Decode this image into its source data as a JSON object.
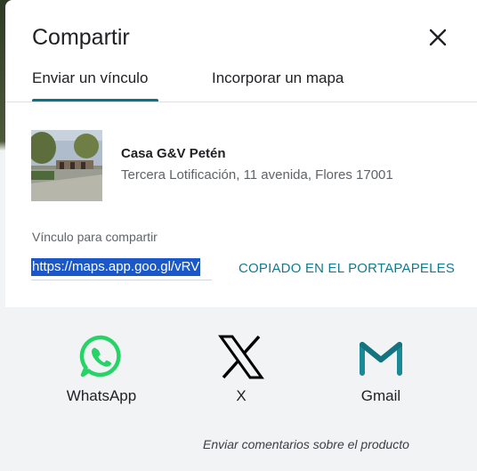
{
  "dialog": {
    "title": "Compartir",
    "close_icon": "close-icon"
  },
  "tabs": [
    {
      "label": "Enviar un vínculo",
      "active": true
    },
    {
      "label": "Incorporar un mapa",
      "active": false
    }
  ],
  "place": {
    "name": "Casa G&V Petén",
    "address": "Tercera Lotificación, 11 avenida, Flores 17001"
  },
  "share_link": {
    "label": "Vínculo para compartir",
    "url": "https://maps.app.goo.gl/vRV",
    "copied_status": "COPIADO EN EL PORTAPAPELES"
  },
  "share_targets": [
    {
      "label": "WhatsApp",
      "icon": "whatsapp-icon",
      "color": "#25d366"
    },
    {
      "label": "X",
      "icon": "x-logo-icon",
      "color": "#000000"
    },
    {
      "label": "Gmail",
      "icon": "gmail-icon",
      "color": "#1a8a96"
    }
  ],
  "feedback": "Enviar comentarios sobre el producto",
  "colors": {
    "accent": "#0b7285",
    "link_selection": "#1a57c9",
    "footer_bg": "#f1f3f4"
  }
}
